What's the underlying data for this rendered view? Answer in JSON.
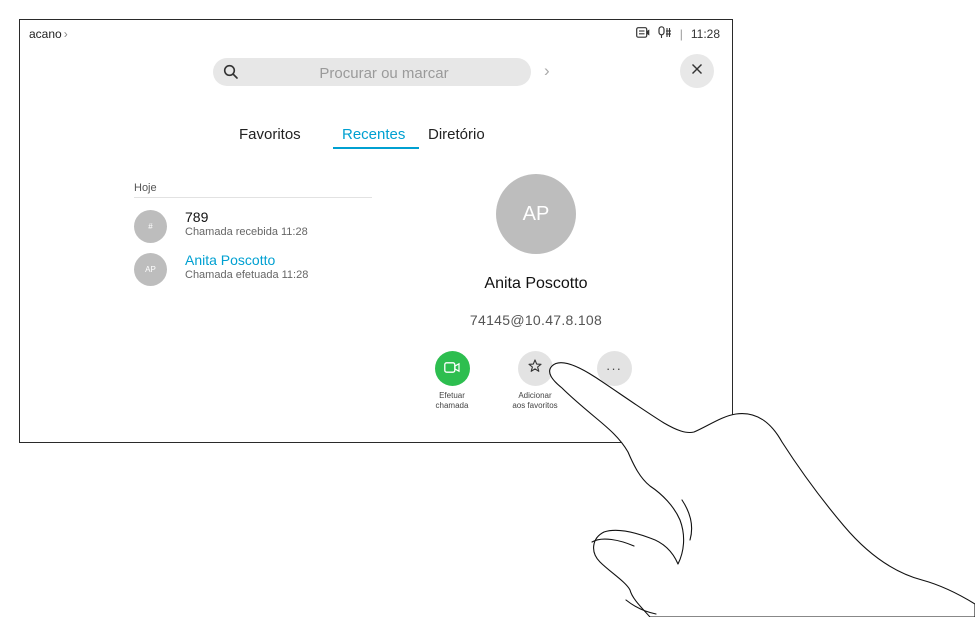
{
  "topbar": {
    "app_name": "acano",
    "app_chevron": "›",
    "separator": "|",
    "time": "11:28",
    "icons": [
      "screen-share-icon",
      "mic-icon"
    ]
  },
  "search": {
    "placeholder": "Procurar ou marcar",
    "go_label": "›",
    "close_label": "×"
  },
  "tabs": [
    {
      "label": "Favoritos",
      "active": false
    },
    {
      "label": "Recentes",
      "active": true
    },
    {
      "label": "Diretório",
      "active": false
    }
  ],
  "recents": {
    "section": "Hoje",
    "items": [
      {
        "avatar": "#",
        "name": "789",
        "detail": "Chamada recebida 11:28",
        "selected": false
      },
      {
        "avatar": "AP",
        "name": "Anita Poscotto",
        "detail": "Chamada efetuada 11:28",
        "selected": true
      }
    ]
  },
  "contact": {
    "initials": "AP",
    "name": "Anita Poscotto",
    "address": "74145@10.47.8.108"
  },
  "actions": [
    {
      "label_line1": "Efetuar",
      "label_line2": "chamada",
      "icon": "video-camera-icon"
    },
    {
      "label_line1": "Adicionar",
      "label_line2": "aos favoritos",
      "icon": "star-icon"
    },
    {
      "label_line1": "",
      "label_line2": "",
      "icon": "more-icon",
      "symbol": "···"
    }
  ],
  "colors": {
    "accent": "#00a0d1",
    "call_green": "#2dbe4f",
    "avatar_gray": "#bdbdbd",
    "search_bg": "#e7e7e7"
  }
}
